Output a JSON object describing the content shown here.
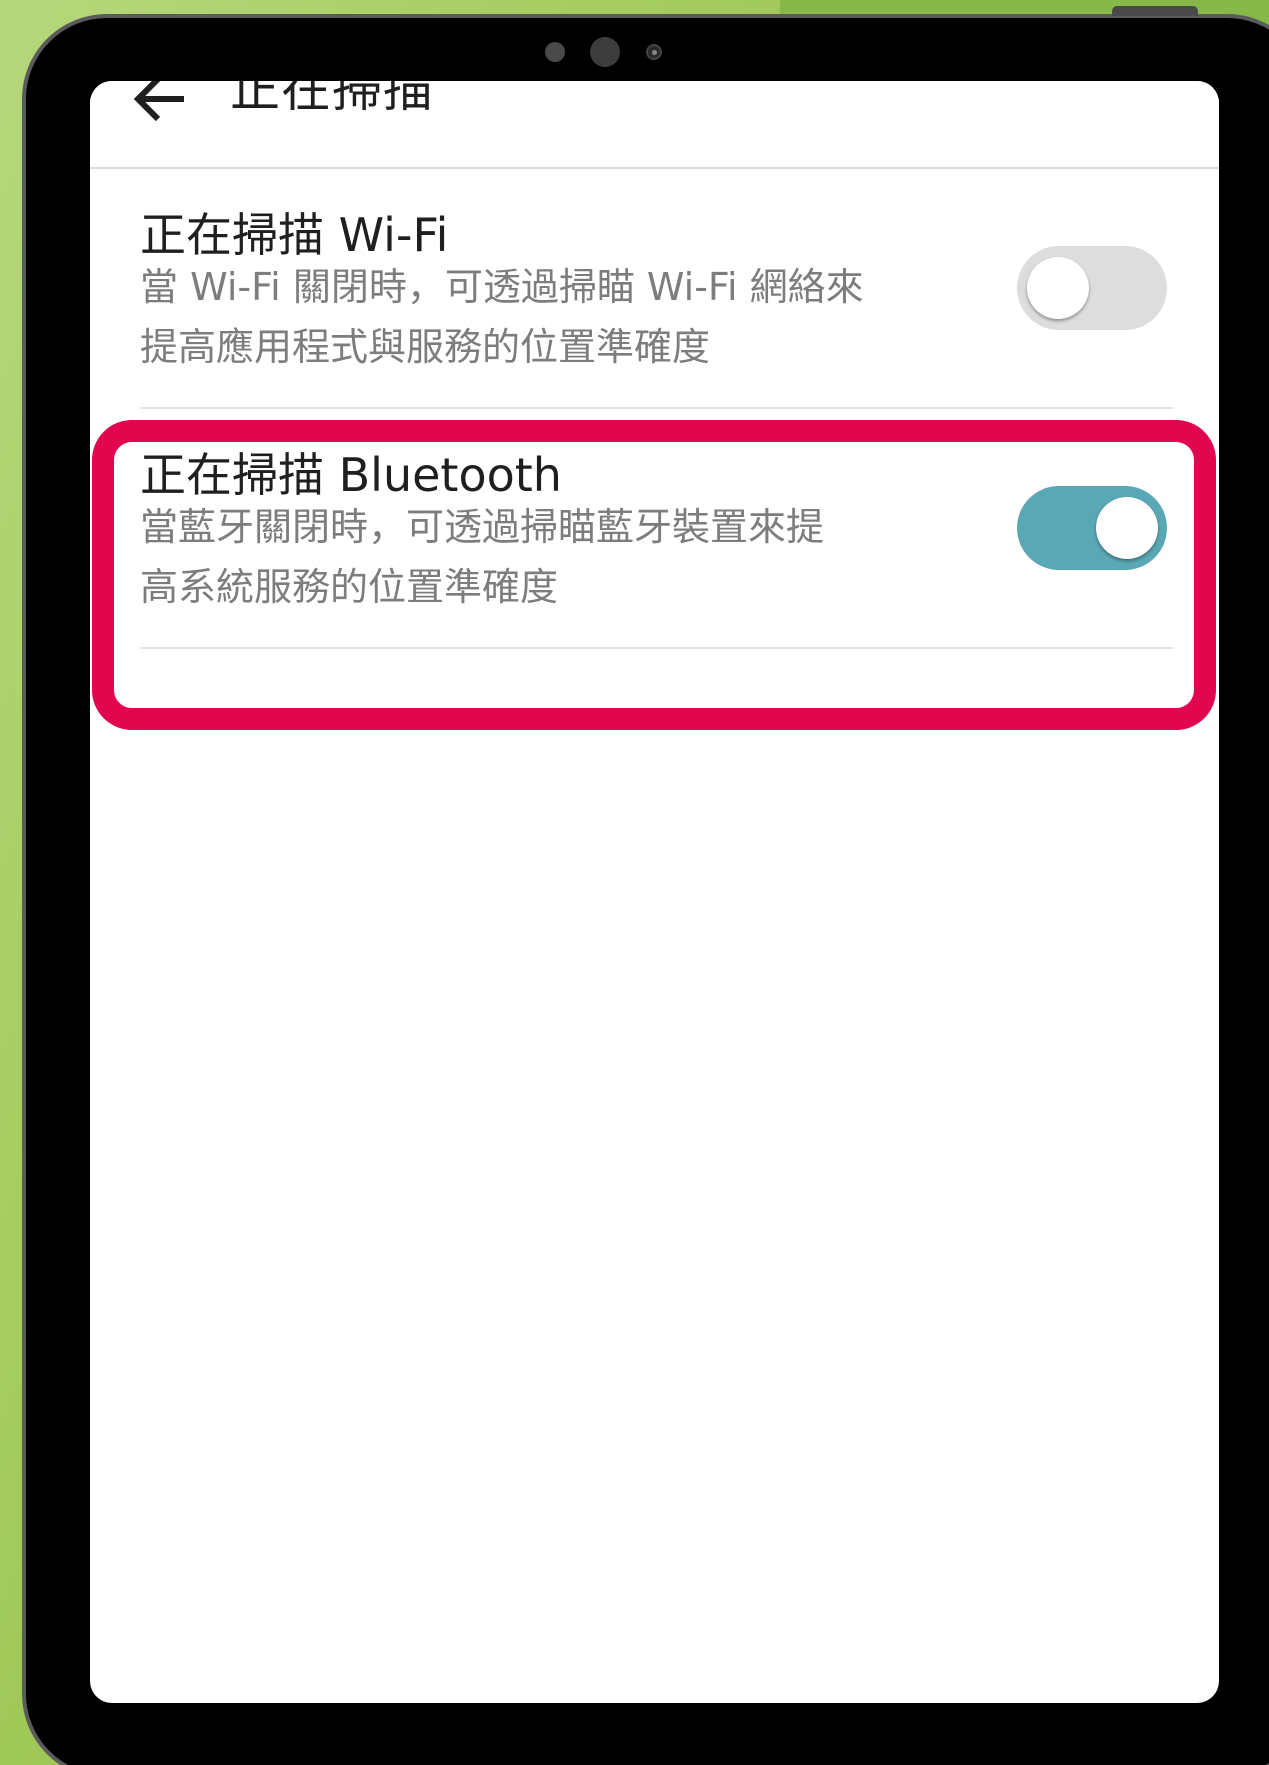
{
  "appbar": {
    "title": "正在掃描"
  },
  "settings": {
    "wifi": {
      "title": "正在掃描 Wi-Fi",
      "description_line1": "當 Wi-Fi 關閉時，可透過掃瞄 Wi-Fi 網絡來",
      "description_line2": "提高應用程式與服務的位置準確度",
      "toggle_state": "off"
    },
    "bluetooth": {
      "title": "正在掃描 Bluetooth",
      "description_line1": "當藍牙關閉時，可透過掃瞄藍牙裝置來提",
      "description_line2": "高系統服務的位置準確度",
      "toggle_state": "on"
    }
  },
  "colors": {
    "toggle_on": "#5aa8b5",
    "toggle_off": "#dddddd",
    "highlight": "#e2064e",
    "background": "#9fc65a"
  }
}
